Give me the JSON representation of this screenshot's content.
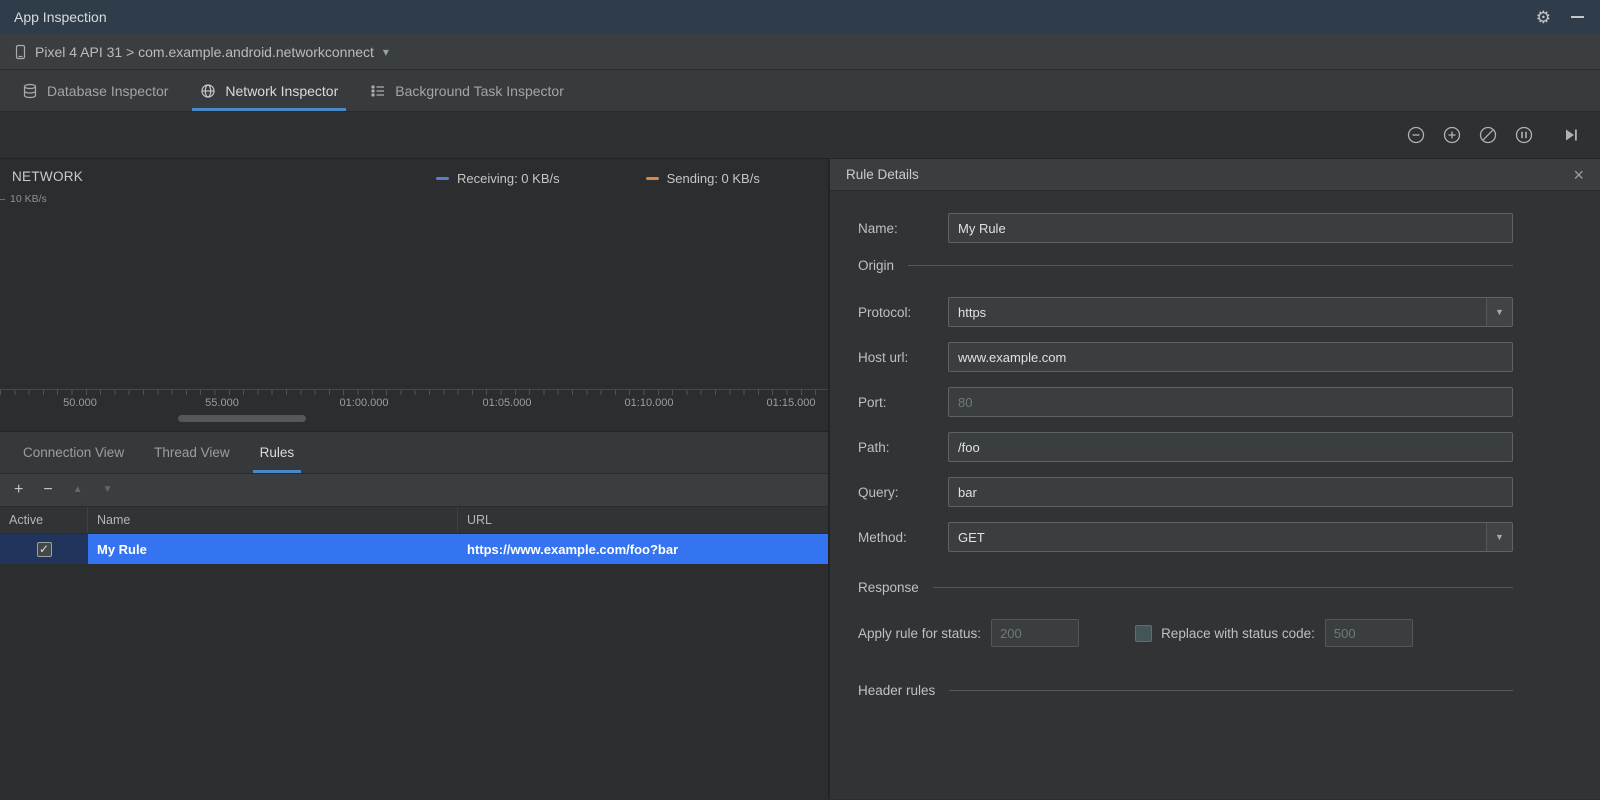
{
  "titlebar": {
    "title": "App Inspection"
  },
  "device_bar": {
    "selector_label": "Pixel 4 API 31 > com.example.android.networkconnect"
  },
  "inspector_tabs": [
    {
      "label": "Database Inspector",
      "active": false
    },
    {
      "label": "Network Inspector",
      "active": true
    },
    {
      "label": "Background Task Inspector",
      "active": false
    }
  ],
  "top_toolbar": {
    "icons": [
      "zoom-out",
      "zoom-in",
      "reset-zoom",
      "pause-live",
      "jump-to-end"
    ]
  },
  "chart": {
    "title": "NETWORK",
    "y_axis_label": "10 KB/s",
    "legend": [
      {
        "label": "Receiving: 0 KB/s",
        "color": "#5b7fc7"
      },
      {
        "label": "Sending: 0 KB/s",
        "color": "#d08a4a"
      }
    ],
    "x_ticks": [
      "50.000",
      "55.000",
      "01:00.000",
      "01:05.000",
      "01:10.000",
      "01:15.000"
    ]
  },
  "chart_data": {
    "type": "area",
    "title": "NETWORK",
    "x_tick_labels": [
      "50.000",
      "55.000",
      "01:00.000",
      "01:05.000",
      "01:10.000",
      "01:15.000"
    ],
    "ylim": [
      0,
      10
    ],
    "y_unit": "KB/s",
    "legend_position": "top",
    "series": [
      {
        "name": "Receiving",
        "unit": "KB/s",
        "current_value": 0,
        "color": "#5b7fc7",
        "values": [
          0,
          0,
          0,
          0,
          0,
          0
        ]
      },
      {
        "name": "Sending",
        "unit": "KB/s",
        "current_value": 0,
        "color": "#d08a4a",
        "values": [
          0,
          0,
          0,
          0,
          0,
          0
        ]
      }
    ]
  },
  "view_tabs": [
    {
      "label": "Connection View",
      "active": false
    },
    {
      "label": "Thread View",
      "active": false
    },
    {
      "label": "Rules",
      "active": true
    }
  ],
  "rules_toolbar": {
    "icons": [
      "add-rule",
      "remove-rule",
      "move-up",
      "move-down"
    ]
  },
  "rules_table": {
    "headers": [
      "Active",
      "Name",
      "URL"
    ],
    "rows": [
      {
        "active": true,
        "name": "My Rule",
        "url": "https://www.example.com/foo?bar"
      }
    ]
  },
  "rule_details": {
    "title": "Rule Details",
    "name_label": "Name:",
    "name_value": "My Rule",
    "sections": {
      "origin": "Origin",
      "response": "Response",
      "header_rules": "Header rules"
    },
    "origin_fields": {
      "protocol_label": "Protocol:",
      "protocol_value": "https",
      "host_label": "Host url:",
      "host_value": "www.example.com",
      "port_label": "Port:",
      "port_placeholder": "80",
      "path_label": "Path:",
      "path_value": "/foo",
      "query_label": "Query:",
      "query_value": "bar",
      "method_label": "Method:",
      "method_value": "GET"
    },
    "response_fields": {
      "status_label": "Apply rule for status:",
      "status_placeholder": "200",
      "replace_checkbox_checked": false,
      "replace_label": "Replace with status code:",
      "replace_placeholder": "500"
    }
  },
  "icons": {
    "gear": "⚙",
    "chevron_down": "▾",
    "close": "×",
    "check": "✓",
    "plus": "+",
    "minus": "−",
    "move_up": "▲",
    "move_down": "▼",
    "combo_arrow": "▼"
  },
  "colors": {
    "selection_blue": "#3574f0",
    "tab_underline": "#4a88c7",
    "titlebar": "#2f3d4a",
    "panel": "#313335",
    "bar": "#3b3e40"
  }
}
